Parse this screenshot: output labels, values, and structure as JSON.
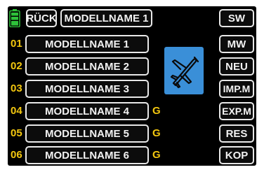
{
  "header": {
    "back_label": "RÜCK",
    "current_model": "MODELLNAME 1"
  },
  "models": [
    {
      "num": "01",
      "name": "MODELLNAME 1",
      "flag": ""
    },
    {
      "num": "02",
      "name": "MODELLNAME 2",
      "flag": ""
    },
    {
      "num": "03",
      "name": "MODELLNAME 3",
      "flag": ""
    },
    {
      "num": "04",
      "name": "MODELLNAME 4",
      "flag": "G"
    },
    {
      "num": "05",
      "name": "MODELLNAME 5",
      "flag": "G"
    },
    {
      "num": "06",
      "name": "MODELLNAME 6",
      "flag": "G"
    }
  ],
  "side_buttons": [
    "SW",
    "MW",
    "NEU",
    "IMP.M",
    "EXP.M",
    "RES",
    "KOP"
  ],
  "colors": {
    "accent_yellow": "#f3c70f",
    "battery_green": "#2ec23a",
    "icon_box_blue": "#3a8fd8",
    "button_border": "#e8e8e8"
  },
  "icons": {
    "battery": "battery-icon",
    "model_type": "airplane-icon"
  }
}
